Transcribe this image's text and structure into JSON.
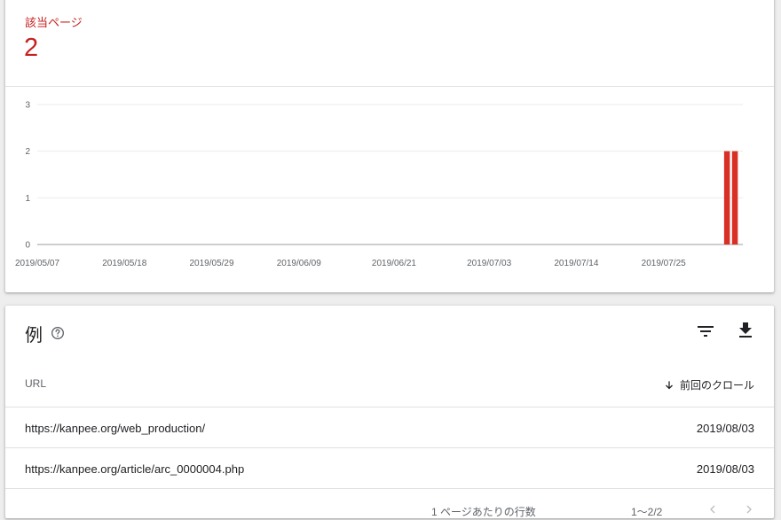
{
  "summary": {
    "label": "該当ページ",
    "value": "2"
  },
  "colors": {
    "accent": "#c5221f",
    "bar": "#d93025",
    "grid": "#ebebeb",
    "axis": "#9e9e9e"
  },
  "chart_data": {
    "type": "bar",
    "x_ticks": [
      "2019/05/07",
      "2019/05/18",
      "2019/05/29",
      "2019/06/09",
      "2019/06/21",
      "2019/07/03",
      "2019/07/14",
      "2019/07/25"
    ],
    "y_ticks": [
      "0",
      "1",
      "2",
      "3"
    ],
    "ylim": [
      0,
      3
    ],
    "xlim": [
      "2019/05/07",
      "2019/08/04"
    ],
    "points": [
      {
        "date": "2019/08/02",
        "value": 2
      },
      {
        "date": "2019/08/03",
        "value": 2
      }
    ],
    "grid": true
  },
  "examples": {
    "title": "例",
    "columns": {
      "url": "URL",
      "last_crawl": "前回のクロール"
    },
    "rows": [
      {
        "url": "https://kanpee.org/web_production/",
        "date": "2019/08/03"
      },
      {
        "url": "https://kanpee.org/article/arc_0000004.php",
        "date": "2019/08/03"
      }
    ],
    "pager": {
      "rows_per_page_label": "1 ページあたりの行数",
      "range": "1～2/2"
    }
  }
}
